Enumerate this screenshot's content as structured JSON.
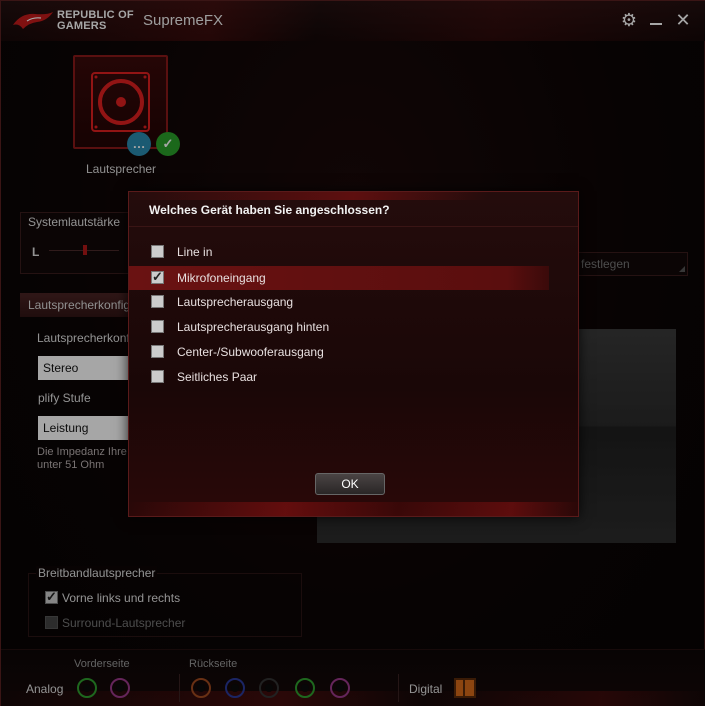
{
  "titlebar": {
    "logo_line1": "REPUBLIC OF",
    "logo_line2": "GAMERS",
    "app_title": "SupremeFX",
    "settings_icon": "gear-icon",
    "minimize_icon": "minimize-icon",
    "close_icon": "close-icon"
  },
  "device": {
    "label": "Lautsprecher",
    "icon": "speaker-icon",
    "badges": [
      "chat-bubble-icon",
      "checkmark-icon"
    ]
  },
  "system_volume": {
    "label": "Systemlautstärke",
    "left_label": "L"
  },
  "speaker_config": {
    "tab_label": "Lautsprecherkonfig",
    "config_label": "Lautsprecherkonf",
    "config_value": "Stereo",
    "amplify_label": "plify Stufe",
    "amplify_value": "Leistung",
    "impedance_note_line1": "Die Impedanz Ihre",
    "impedance_note_line2": "unter 51 Ohm",
    "set_field": "festlegen"
  },
  "broadband": {
    "label": "Breitbandlautsprecher",
    "front": {
      "label": "Vorne links und rechts",
      "checked": true
    },
    "surround": {
      "label": "Surround-Lautsprecher",
      "checked": false
    }
  },
  "bottom": {
    "front_label": "Vorderseite",
    "rear_label": "Rückseite",
    "analog_label": "Analog",
    "digital_label": "Digital",
    "front_jacks": [
      "#2e9e2e",
      "#9a3a8a"
    ],
    "rear_jacks": [
      "#a04a20",
      "#2a3a9a",
      "#333333",
      "#2e9e2e",
      "#9a3a8a"
    ]
  },
  "modal": {
    "title": "Welches Gerät haben Sie angeschlossen?",
    "options": [
      {
        "label": "Line in",
        "checked": false
      },
      {
        "label": "Mikrofoneingang",
        "checked": true
      },
      {
        "label": "Lautsprecherausgang",
        "checked": false
      },
      {
        "label": "Lautsprecherausgang hinten",
        "checked": false
      },
      {
        "label": "Center-/Subwooferausgang",
        "checked": false
      },
      {
        "label": "Seitliches Paar",
        "checked": false
      }
    ],
    "ok_label": "OK"
  },
  "colors": {
    "accent_red": "#8a1a1a",
    "selected_row": "#6a1212",
    "badge_blue": "#2a8ab0",
    "badge_green": "#2aa02a"
  }
}
